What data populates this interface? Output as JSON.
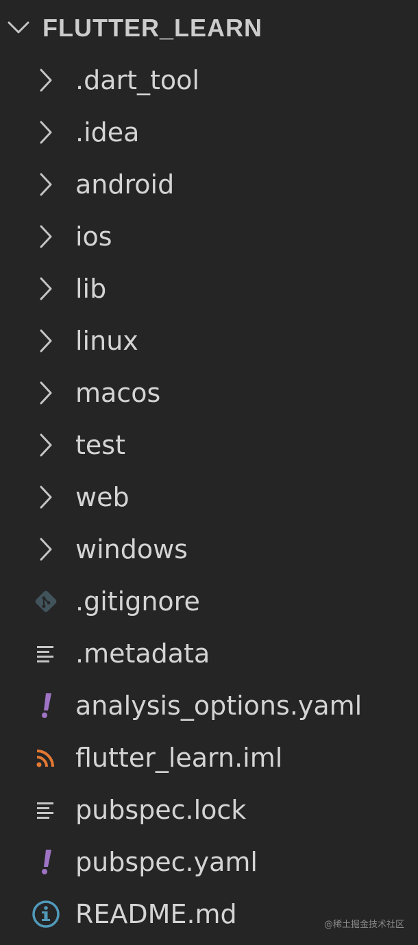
{
  "explorer": {
    "root": {
      "title": "FLUTTER_LEARN",
      "icon": "chevron-down-icon"
    },
    "folders": [
      {
        "label": ".dart_tool",
        "icon": "chevron-right-icon"
      },
      {
        "label": ".idea",
        "icon": "chevron-right-icon"
      },
      {
        "label": "android",
        "icon": "chevron-right-icon"
      },
      {
        "label": "ios",
        "icon": "chevron-right-icon"
      },
      {
        "label": "lib",
        "icon": "chevron-right-icon"
      },
      {
        "label": "linux",
        "icon": "chevron-right-icon"
      },
      {
        "label": "macos",
        "icon": "chevron-right-icon"
      },
      {
        "label": "test",
        "icon": "chevron-right-icon"
      },
      {
        "label": "web",
        "icon": "chevron-right-icon"
      },
      {
        "label": "windows",
        "icon": "chevron-right-icon"
      }
    ],
    "files": [
      {
        "label": ".gitignore",
        "icon": "git-file-icon",
        "icon_color": "#41535b"
      },
      {
        "label": ".metadata",
        "icon": "text-lines-icon",
        "icon_color": "#c5c5c5"
      },
      {
        "label": "analysis_options.yaml",
        "icon": "yaml-exclamation-icon",
        "icon_color": "#a074c4"
      },
      {
        "label": "flutter_learn.iml",
        "icon": "rss-feed-icon",
        "icon_color": "#e37933"
      },
      {
        "label": "pubspec.lock",
        "icon": "text-lines-icon",
        "icon_color": "#c5c5c5"
      },
      {
        "label": "pubspec.yaml",
        "icon": "yaml-exclamation-icon",
        "icon_color": "#a074c4"
      },
      {
        "label": "README.md",
        "icon": "info-icon",
        "icon_color": "#519aba"
      }
    ]
  },
  "watermark": "@稀土掘金技术社区",
  "colors": {
    "background": "#252526",
    "text": "#d4d4d4",
    "chevron": "#c5c5c5"
  }
}
